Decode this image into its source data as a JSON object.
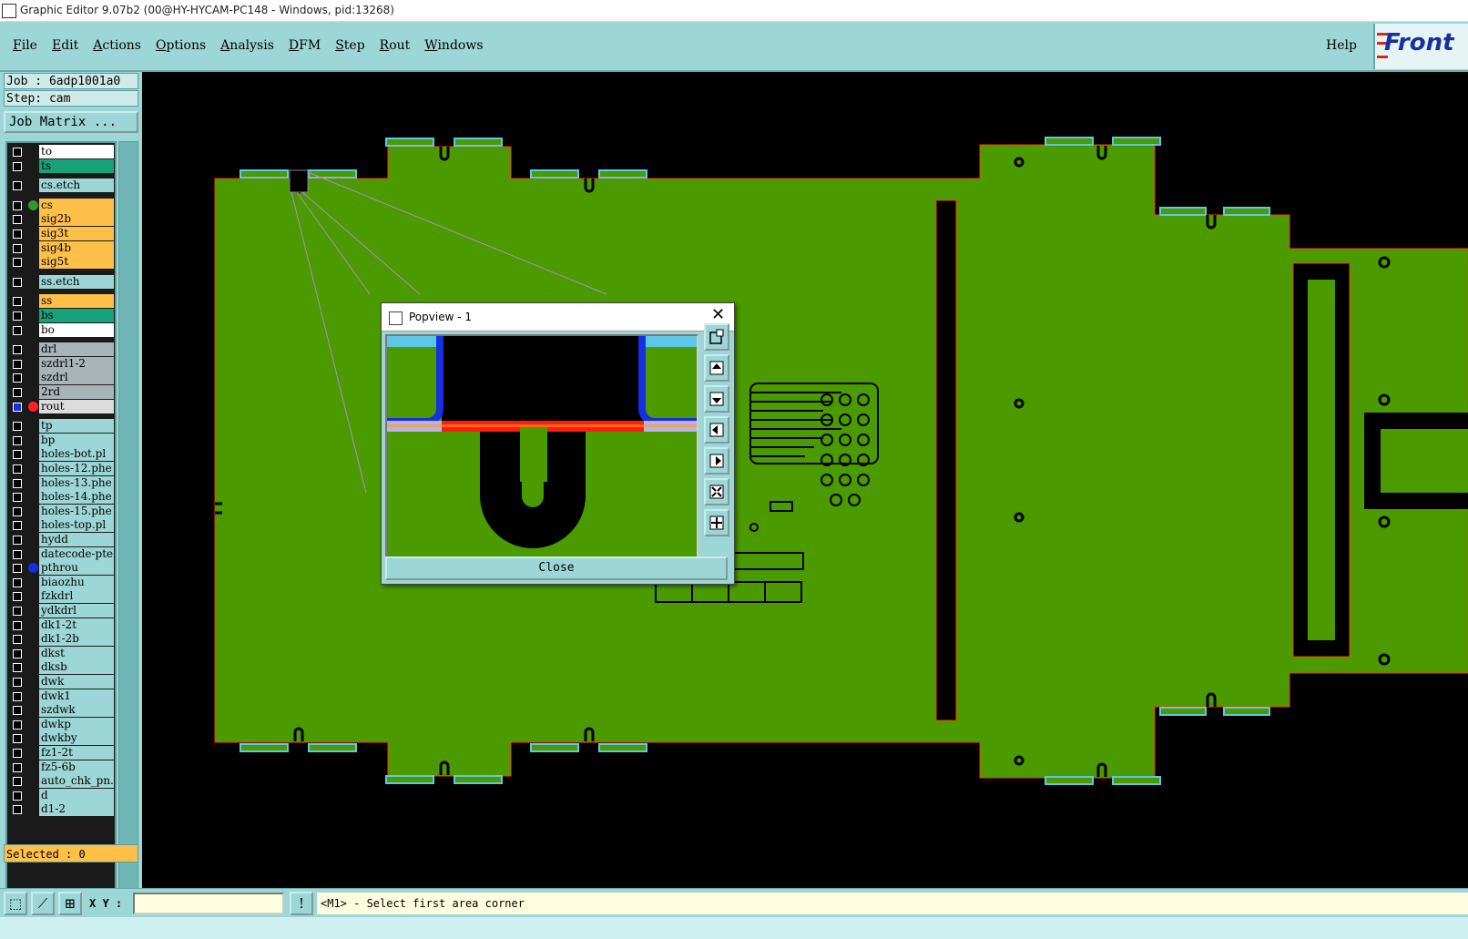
{
  "window": {
    "title": "Graphic Editor 9.07b2 (00@HY-HYCAM-PC148 - Windows, pid:13268)"
  },
  "menu": {
    "items": [
      "File",
      "Edit",
      "Actions",
      "Options",
      "Analysis",
      "DFM",
      "Step",
      "Rout",
      "Windows"
    ],
    "help": "Help",
    "logo": "Front"
  },
  "job": {
    "job_line": "Job : 6adp1001a0",
    "step_line": "Step: cam",
    "matrix_button": "Job Matrix ..."
  },
  "layers": [
    {
      "name": "to",
      "color": "#ffffff",
      "dot": ""
    },
    {
      "name": "ts",
      "color": "#17a27a",
      "dot": ""
    },
    {
      "name": "cs.etch",
      "color": "#9dd6d6",
      "dot": ""
    },
    {
      "name": "cs",
      "color": "#ffc04a",
      "dot": "#2e9a2e"
    },
    {
      "name": "sig2b",
      "color": "#ffc04a",
      "dot": ""
    },
    {
      "name": "sig3t",
      "color": "#ffc04a",
      "dot": ""
    },
    {
      "name": "sig4b",
      "color": "#ffc04a",
      "dot": ""
    },
    {
      "name": "sig5t",
      "color": "#ffc04a",
      "dot": ""
    },
    {
      "name": "ss.etch",
      "color": "#9dd6d6",
      "dot": ""
    },
    {
      "name": "ss",
      "color": "#ffc04a",
      "dot": ""
    },
    {
      "name": "bs",
      "color": "#17a27a",
      "dot": ""
    },
    {
      "name": "bo",
      "color": "#ffffff",
      "dot": ""
    },
    {
      "name": "drl",
      "color": "#a9b4b9",
      "dot": ""
    },
    {
      "name": "szdrl1-2",
      "color": "#a9b4b9",
      "dot": ""
    },
    {
      "name": "szdrl",
      "color": "#a9b4b9",
      "dot": ""
    },
    {
      "name": "2rd",
      "color": "#a9b4b9",
      "dot": ""
    },
    {
      "name": "rout",
      "color": "#dcdcdc",
      "dot": "#ff2020",
      "active": true
    },
    {
      "name": "tp",
      "color": "#9dd6d6",
      "dot": ""
    },
    {
      "name": "bp",
      "color": "#9dd6d6",
      "dot": ""
    },
    {
      "name": "holes-bot.pl",
      "color": "#9dd6d6",
      "dot": ""
    },
    {
      "name": "holes-12.phe",
      "color": "#9dd6d6",
      "dot": ""
    },
    {
      "name": "holes-13.phe",
      "color": "#9dd6d6",
      "dot": ""
    },
    {
      "name": "holes-14.phe",
      "color": "#9dd6d6",
      "dot": ""
    },
    {
      "name": "holes-15.phe",
      "color": "#9dd6d6",
      "dot": ""
    },
    {
      "name": "holes-top.pl",
      "color": "#9dd6d6",
      "dot": ""
    },
    {
      "name": "hydd",
      "color": "#9dd6d6",
      "dot": ""
    },
    {
      "name": "datecode-pte",
      "color": "#9dd6d6",
      "dot": ""
    },
    {
      "name": "pthrou",
      "color": "#9dd6d6",
      "dot": "#1530e0"
    },
    {
      "name": "biaozhu",
      "color": "#9dd6d6",
      "dot": ""
    },
    {
      "name": "fzkdrl",
      "color": "#9dd6d6",
      "dot": ""
    },
    {
      "name": "ydkdrl",
      "color": "#9dd6d6",
      "dot": ""
    },
    {
      "name": "dk1-2t",
      "color": "#9dd6d6",
      "dot": ""
    },
    {
      "name": "dk1-2b",
      "color": "#9dd6d6",
      "dot": ""
    },
    {
      "name": "dkst",
      "color": "#9dd6d6",
      "dot": ""
    },
    {
      "name": "dksb",
      "color": "#9dd6d6",
      "dot": ""
    },
    {
      "name": "dwk",
      "color": "#9dd6d6",
      "dot": ""
    },
    {
      "name": "dwk1",
      "color": "#9dd6d6",
      "dot": ""
    },
    {
      "name": "szdwk",
      "color": "#9dd6d6",
      "dot": ""
    },
    {
      "name": "dwkp",
      "color": "#9dd6d6",
      "dot": ""
    },
    {
      "name": "dwkby",
      "color": "#9dd6d6",
      "dot": ""
    },
    {
      "name": "fz1-2t",
      "color": "#9dd6d6",
      "dot": ""
    },
    {
      "name": "fz5-6b",
      "color": "#9dd6d6",
      "dot": ""
    },
    {
      "name": "auto_chk_pn.",
      "color": "#9dd6d6",
      "dot": ""
    },
    {
      "name": "d",
      "color": "#9dd6d6",
      "dot": ""
    },
    {
      "name": "d1-2",
      "color": "#9dd6d6",
      "dot": ""
    }
  ],
  "selected": "Selected : 0",
  "status": {
    "xy_label": "X Y :",
    "xy_value": "",
    "message": "<M1> - Select first area corner"
  },
  "popview": {
    "title": "Popview - 1",
    "close_label": "Close"
  },
  "colors": {
    "board_green": "#4a9a00",
    "panel_teal": "#9dd6d6",
    "rout_red": "#ff2020",
    "tab_cyan": "#5bc8e8"
  }
}
